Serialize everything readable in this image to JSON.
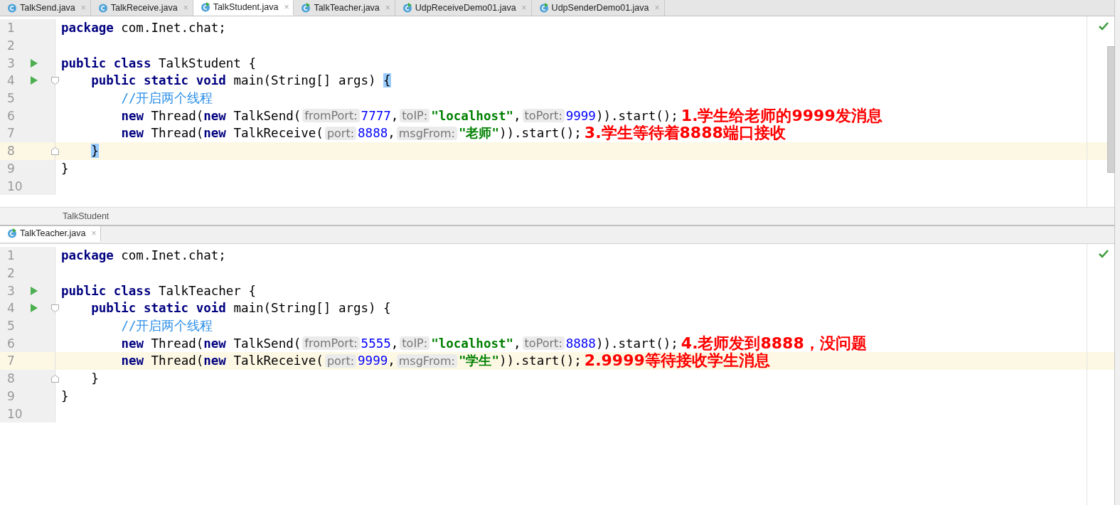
{
  "tabs": [
    {
      "label": "TalkSend.java",
      "close": "×",
      "runnable": false,
      "selected": false
    },
    {
      "label": "TalkReceive.java",
      "close": "×",
      "runnable": false,
      "selected": false
    },
    {
      "label": "TalkStudent.java",
      "close": "×",
      "runnable": true,
      "selected": true
    },
    {
      "label": "TalkTeacher.java",
      "close": "×",
      "runnable": true,
      "selected": false
    },
    {
      "label": "UdpReceiveDemo01.java",
      "close": "×",
      "runnable": true,
      "selected": false
    },
    {
      "label": "UdpSenderDemo01.java",
      "close": "×",
      "runnable": true,
      "selected": false
    }
  ],
  "top_editor": {
    "lines": [
      {
        "number": "1",
        "kind": "top",
        "runnable": false,
        "fold_open": false,
        "fold_close": false,
        "current": false,
        "segments": [
          {
            "kind": "keyword",
            "text": "package"
          },
          {
            "kind": "plain",
            "text": " com.Inet.chat;"
          }
        ]
      },
      {
        "number": "2",
        "kind": "top",
        "runnable": false,
        "fold_open": false,
        "fold_close": false,
        "current": false
      },
      {
        "number": "3",
        "kind": "top",
        "runnable": true,
        "fold_open": false,
        "fold_close": false,
        "current": false,
        "segments": [
          {
            "kind": "keyword",
            "text": "public class"
          },
          {
            "kind": "plain",
            "text": " TalkStudent {"
          }
        ]
      },
      {
        "number": "4",
        "kind": "member",
        "runnable": true,
        "fold_open": true,
        "fold_close": false,
        "current": false,
        "segments": [
          {
            "kind": "keyword",
            "text": "public static void"
          },
          {
            "kind": "plain",
            "text": " main(String[] args) "
          },
          {
            "kind": "brace_match",
            "text": "{"
          }
        ]
      },
      {
        "number": "5",
        "kind": "body",
        "runnable": false,
        "fold_open": false,
        "fold_close": false,
        "current": false,
        "segments": [
          {
            "kind": "comment",
            "text": "//开启两个线程"
          }
        ]
      },
      {
        "number": "6",
        "kind": "body",
        "runnable": false,
        "fold_open": false,
        "fold_close": false,
        "current": false,
        "segments": [
          {
            "kind": "keyword",
            "text": "new"
          },
          {
            "kind": "plain",
            "text": " Thread("
          },
          {
            "kind": "keyword",
            "text": "new"
          },
          {
            "kind": "plain",
            "text": " TalkSend("
          },
          {
            "kind": "hint",
            "text": "fromPort:"
          },
          {
            "kind": "number",
            "text": "7777"
          },
          {
            "kind": "plain",
            "text": ","
          },
          {
            "kind": "hint",
            "text": "toIP:"
          },
          {
            "kind": "string",
            "text": "\"localhost\""
          },
          {
            "kind": "plain",
            "text": ","
          },
          {
            "kind": "hint",
            "text": "toPort:"
          },
          {
            "kind": "number",
            "text": "9999"
          },
          {
            "kind": "plain",
            "text": ")).start();"
          }
        ],
        "note": "1.学生给老师的9999发消息"
      },
      {
        "number": "7",
        "kind": "body",
        "runnable": false,
        "fold_open": false,
        "fold_close": false,
        "current": false,
        "segments": [
          {
            "kind": "keyword",
            "text": "new"
          },
          {
            "kind": "plain",
            "text": " Thread("
          },
          {
            "kind": "keyword",
            "text": "new"
          },
          {
            "kind": "plain",
            "text": " TalkReceive("
          },
          {
            "kind": "hint",
            "text": "port:"
          },
          {
            "kind": "number",
            "text": "8888"
          },
          {
            "kind": "plain",
            "text": ","
          },
          {
            "kind": "hint",
            "text": "msgFrom:"
          },
          {
            "kind": "string",
            "text": "\"老师\""
          },
          {
            "kind": "plain",
            "text": ")).start();"
          }
        ],
        "note": "3.学生等待着8888端口接收"
      },
      {
        "number": "8",
        "kind": "member",
        "runnable": false,
        "fold_open": false,
        "fold_close": true,
        "current": true,
        "segments": [
          {
            "kind": "brace_match",
            "text": "}"
          }
        ]
      },
      {
        "number": "9",
        "kind": "top",
        "runnable": false,
        "fold_open": false,
        "fold_close": false,
        "current": false,
        "segments": [
          {
            "kind": "plain",
            "text": "}"
          }
        ]
      },
      {
        "number": "10",
        "kind": "top",
        "runnable": false,
        "fold_open": false,
        "fold_close": false,
        "current": false
      }
    ],
    "breadcrumb": "TalkStudent"
  },
  "bottom_tab": {
    "label": "TalkTeacher.java",
    "close": "×",
    "runnable": true
  },
  "bottom_editor": {
    "lines": [
      {
        "number": "1",
        "kind": "top",
        "runnable": false,
        "fold_open": false,
        "fold_close": false,
        "current": false,
        "segments": [
          {
            "kind": "keyword",
            "text": "package"
          },
          {
            "kind": "plain",
            "text": " com.Inet.chat;"
          }
        ]
      },
      {
        "number": "2",
        "kind": "top",
        "runnable": false,
        "fold_open": false,
        "fold_close": false,
        "current": false
      },
      {
        "number": "3",
        "kind": "top",
        "runnable": true,
        "fold_open": false,
        "fold_close": false,
        "current": false,
        "segments": [
          {
            "kind": "keyword",
            "text": "public class"
          },
          {
            "kind": "plain",
            "text": " TalkTeacher {"
          }
        ]
      },
      {
        "number": "4",
        "kind": "member",
        "runnable": true,
        "fold_open": true,
        "fold_close": false,
        "current": false,
        "segments": [
          {
            "kind": "keyword",
            "text": "public static void"
          },
          {
            "kind": "plain",
            "text": " main(String[] args) {"
          }
        ]
      },
      {
        "number": "5",
        "kind": "body",
        "runnable": false,
        "fold_open": false,
        "fold_close": false,
        "current": false,
        "segments": [
          {
            "kind": "comment",
            "text": "//开启两个线程"
          }
        ]
      },
      {
        "number": "6",
        "kind": "body",
        "runnable": false,
        "fold_open": false,
        "fold_close": false,
        "current": false,
        "segments": [
          {
            "kind": "keyword",
            "text": "new"
          },
          {
            "kind": "plain",
            "text": " Thread("
          },
          {
            "kind": "keyword",
            "text": "new"
          },
          {
            "kind": "plain",
            "text": " TalkSend("
          },
          {
            "kind": "hint",
            "text": "fromPort:"
          },
          {
            "kind": "number",
            "text": "5555"
          },
          {
            "kind": "plain",
            "text": ","
          },
          {
            "kind": "hint",
            "text": "toIP:"
          },
          {
            "kind": "string",
            "text": "\"localhost\""
          },
          {
            "kind": "plain",
            "text": ","
          },
          {
            "kind": "hint",
            "text": "toPort:"
          },
          {
            "kind": "number",
            "text": "8888"
          },
          {
            "kind": "plain",
            "text": ")).start();"
          }
        ],
        "note": "4.老师发到8888，没问题"
      },
      {
        "number": "7",
        "kind": "body",
        "runnable": false,
        "fold_open": false,
        "fold_close": false,
        "current": true,
        "segments": [
          {
            "kind": "keyword",
            "text": "new"
          },
          {
            "kind": "plain",
            "text": " Thread("
          },
          {
            "kind": "keyword",
            "text": "new"
          },
          {
            "kind": "plain",
            "text": " TalkReceive("
          },
          {
            "kind": "hint",
            "text": "port:"
          },
          {
            "kind": "number",
            "text": "9999"
          },
          {
            "kind": "plain",
            "text": ","
          },
          {
            "kind": "hint",
            "text": "msgFrom:"
          },
          {
            "kind": "string",
            "text": "\"学生\""
          },
          {
            "kind": "plain",
            "text": ")).start();"
          }
        ],
        "note": "2.9999等待接收学生消息"
      },
      {
        "number": "8",
        "kind": "member",
        "runnable": false,
        "fold_open": false,
        "fold_close": true,
        "current": false,
        "segments": [
          {
            "kind": "plain",
            "text": "}"
          }
        ]
      },
      {
        "number": "9",
        "kind": "top",
        "runnable": false,
        "fold_open": false,
        "fold_close": false,
        "current": false,
        "segments": [
          {
            "kind": "plain",
            "text": "}"
          }
        ]
      },
      {
        "number": "10",
        "kind": "top",
        "runnable": false,
        "fold_open": false,
        "fold_close": false,
        "current": false
      }
    ]
  }
}
